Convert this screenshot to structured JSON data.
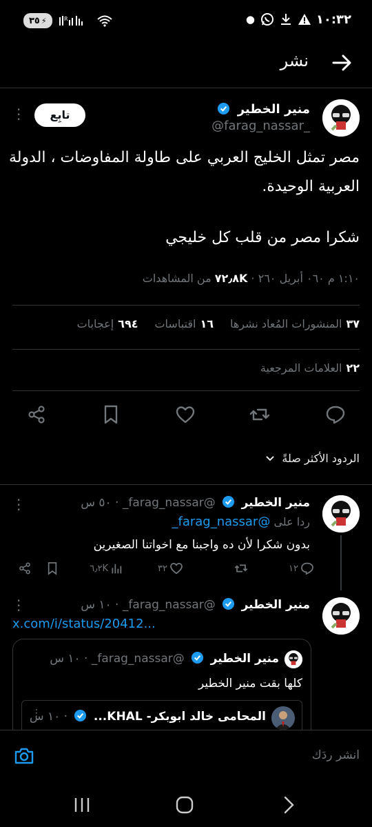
{
  "status_bar": {
    "time": "١٠:٣٢",
    "battery": "٣٥",
    "icons": [
      "dot-icon",
      "whatsapp-icon",
      "download-icon",
      "warning-icon",
      "battery-icon",
      "signal-icon",
      "wifi-icon"
    ]
  },
  "header": {
    "title": "نشر",
    "back_icon": "arrow-right-icon"
  },
  "tweet": {
    "author_name": "منير الخطير",
    "author_handle": "@farag_nassar_",
    "follow_label": "تابِع",
    "text_line1": "مصر تمثل الخليج العربي على طاولة المفاوضات ، الدولة العربية الوحيدة.",
    "text_line2": "شكرا مصر من قلب كل خليجي",
    "timestamp": "١:١٠ م ٠٦٠ أبريل ٢٦٠",
    "views_count": "٧٢٫٨K",
    "views_label": "من المشاهدات"
  },
  "stats": {
    "reposts_count": "٣٧",
    "reposts_label": "المنشورات المُعاد نشرها",
    "quotes_count": "١٦",
    "quotes_label": "اقتباسات",
    "likes_count": "٦٩٤",
    "likes_label": "إعجابات",
    "bookmarks_count": "٢٢",
    "bookmarks_label": "العلامات المرجعية"
  },
  "action_icons": [
    "reply-icon",
    "repost-icon",
    "like-icon",
    "bookmark-icon",
    "share-icon"
  ],
  "sort": {
    "label": "الردود الأكثر صلةً"
  },
  "replies": [
    {
      "author_name": "منير الخطير",
      "author_handle": "@farag_nassar_",
      "time": "٥٠ س",
      "replying_to_label": "ردا على",
      "replying_to_handle": "@farag_nassar_",
      "text": "بدون شكرا لأن ده واجبنا مع اخواتنا الصغيرين",
      "replies_count": "١٢",
      "reposts_count": "",
      "likes_count": "٣٢",
      "views_count": "٦٫٢K"
    },
    {
      "author_name": "منير الخطير",
      "author_handle": "@farag_nassar_",
      "time": "١٠ س",
      "link": "x.com/i/status/20412...",
      "quote": {
        "author_name": "منير الخطير",
        "author_handle": "@farag_nassar_",
        "time": "١٠ س",
        "text": "كلها بقت منير الخطير",
        "inner": {
          "author_name": "المحامى خالد ابوبكر- KHAL...",
          "time": "١٠ س"
        }
      }
    }
  ],
  "composer": {
    "placeholder": "انشر ردَك"
  },
  "colors": {
    "background": "#000000",
    "accent": "#1d9bf0",
    "muted": "#71767b",
    "divider": "#2f3336"
  }
}
